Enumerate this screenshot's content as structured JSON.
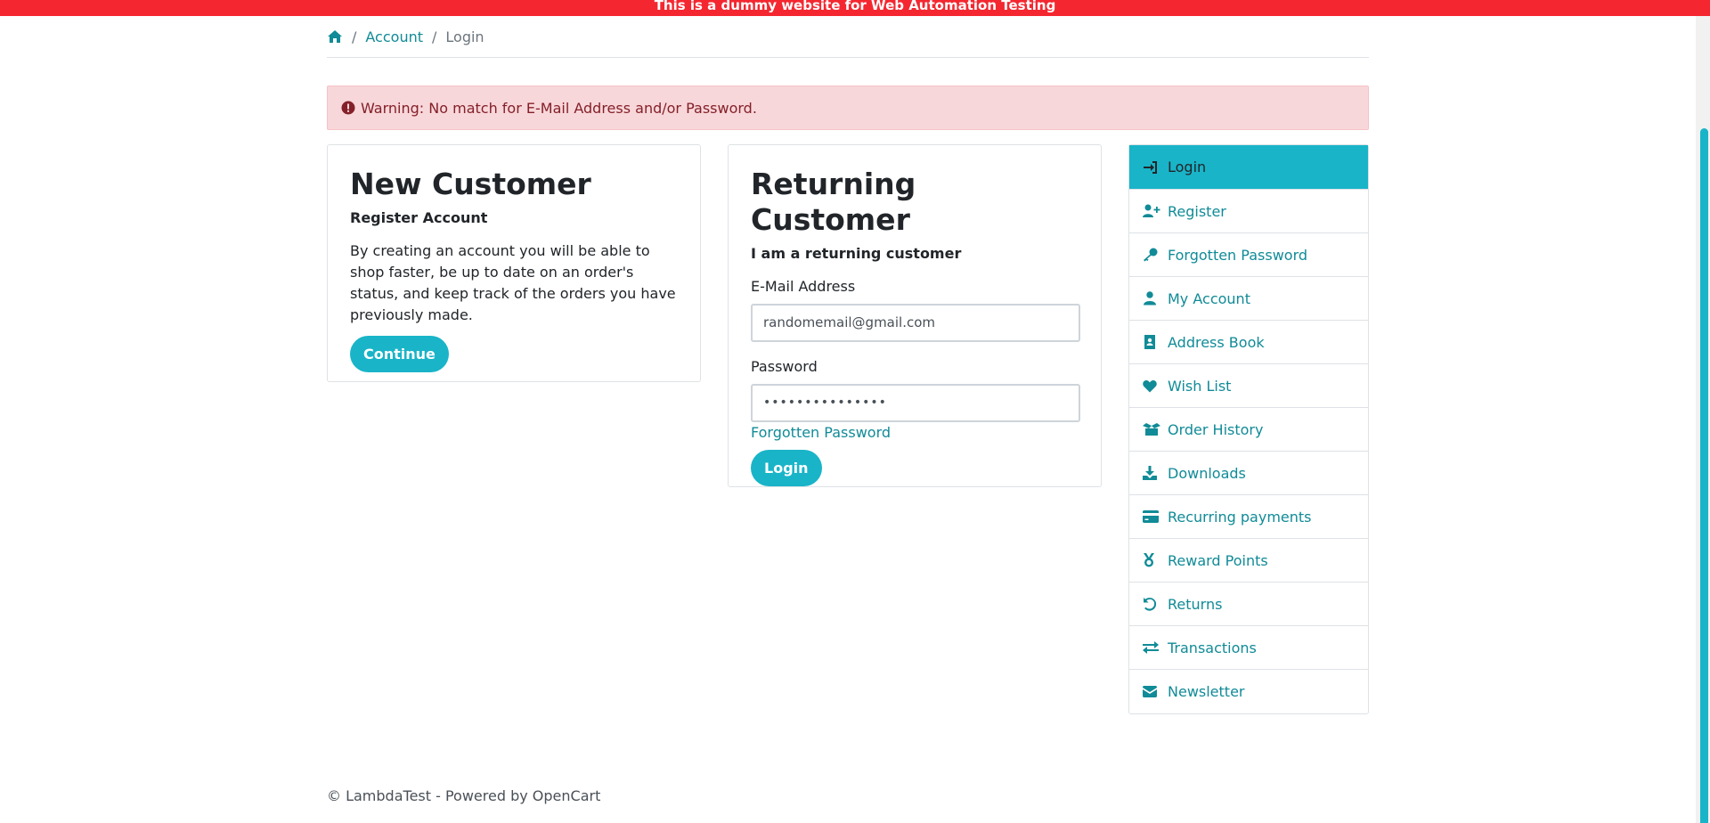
{
  "banner": {
    "text": "This is a dummy website for Web Automation Testing"
  },
  "breadcrumb": {
    "home_icon": "home-icon",
    "sep": "/",
    "account": "Account",
    "current": "Login"
  },
  "alert": {
    "icon": "exclamation-circle-icon",
    "text": "Warning: No match for E-Mail Address and/or Password."
  },
  "new_customer": {
    "title": "New Customer",
    "subtitle": "Register Account",
    "body": "By creating an account you will be able to shop faster, be up to date on an order's status, and keep track of the orders you have previously made.",
    "button": "Continue"
  },
  "returning_customer": {
    "title": "Returning Customer",
    "subtitle": "I am a returning customer",
    "email_label": "E-Mail Address",
    "email_value": "randomemail@gmail.com",
    "password_label": "Password",
    "password_value": "•••••••••••••••",
    "forgotten_link": "Forgotten Password",
    "button": "Login"
  },
  "sidebar": {
    "items": [
      {
        "label": "Login",
        "icon": "sign-in-icon",
        "active": true
      },
      {
        "label": "Register",
        "icon": "user-plus-icon"
      },
      {
        "label": "Forgotten Password",
        "icon": "key-icon"
      },
      {
        "label": "My Account",
        "icon": "user-icon"
      },
      {
        "label": "Address Book",
        "icon": "address-book-icon"
      },
      {
        "label": "Wish List",
        "icon": "heart-icon"
      },
      {
        "label": "Order History",
        "icon": "box-open-icon"
      },
      {
        "label": "Downloads",
        "icon": "download-icon"
      },
      {
        "label": "Recurring payments",
        "icon": "credit-card-icon"
      },
      {
        "label": "Reward Points",
        "icon": "medal-icon"
      },
      {
        "label": "Returns",
        "icon": "undo-icon"
      },
      {
        "label": "Transactions",
        "icon": "exchange-icon"
      },
      {
        "label": "Newsletter",
        "icon": "envelope-icon"
      }
    ]
  },
  "footer": {
    "prefix": "© LambdaTest - Powered by ",
    "link": "OpenCart"
  },
  "colors": {
    "banner": "#f42730",
    "accent": "#19b4c8",
    "link": "#108b97",
    "alert_bg": "#f8d7da",
    "alert_text": "#842029"
  }
}
